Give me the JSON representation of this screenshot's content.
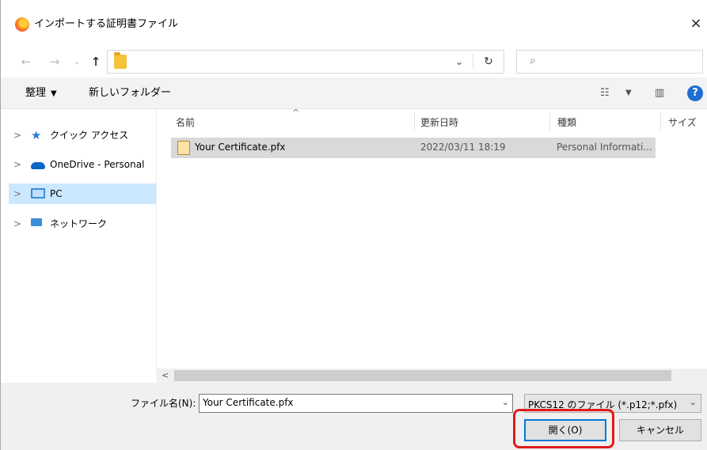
{
  "window": {
    "title": "インポートする証明書ファイル",
    "close_glyph": "×"
  },
  "nav": {
    "back_glyph": "←",
    "forward_glyph": "→",
    "recent_glyph": "⌄",
    "up_glyph": "↑",
    "address_dropdown_glyph": "⌄",
    "refresh_glyph": "↻",
    "search_placeholder": "",
    "search_glyph": "⌕"
  },
  "toolbar": {
    "organize": "整理",
    "organize_caret": "▼",
    "new_folder": "新しいフォルダー",
    "view_glyph": "☷",
    "view_caret": "▼",
    "pane_glyph": "▥",
    "help_glyph": "?"
  },
  "sidebar": {
    "items": [
      {
        "label": "クイック アクセス",
        "chev": ">",
        "icon": "star-icon"
      },
      {
        "label": "OneDrive - Personal",
        "chev": ">",
        "icon": "cloud-icon"
      },
      {
        "label": "PC",
        "chev": ">",
        "icon": "pc-icon"
      },
      {
        "label": "ネットワーク",
        "chev": ">",
        "icon": "network-icon"
      }
    ]
  },
  "columns": {
    "name": "名前",
    "date": "更新日時",
    "type": "種類",
    "size": "サイズ",
    "sort_glyph": "^"
  },
  "files": [
    {
      "name": "Your Certificate.pfx",
      "date": "2022/03/11 18:19",
      "type": "Personal Informati..."
    }
  ],
  "scroll": {
    "left_glyph": "<"
  },
  "bottom": {
    "file_name_label": "ファイル名(N):",
    "file_name_value": "Your Certificate.pfx",
    "file_name_drop": "⌄",
    "filter_value": "PKCS12 のファイル (*.p12;*.pfx)",
    "filter_drop": "⌄",
    "open_button": "開く(O)",
    "cancel_button": "キャンセル"
  },
  "colors": {
    "highlight": "#e21b1b",
    "selection": "#cce8ff",
    "accent": "#0078d7"
  }
}
